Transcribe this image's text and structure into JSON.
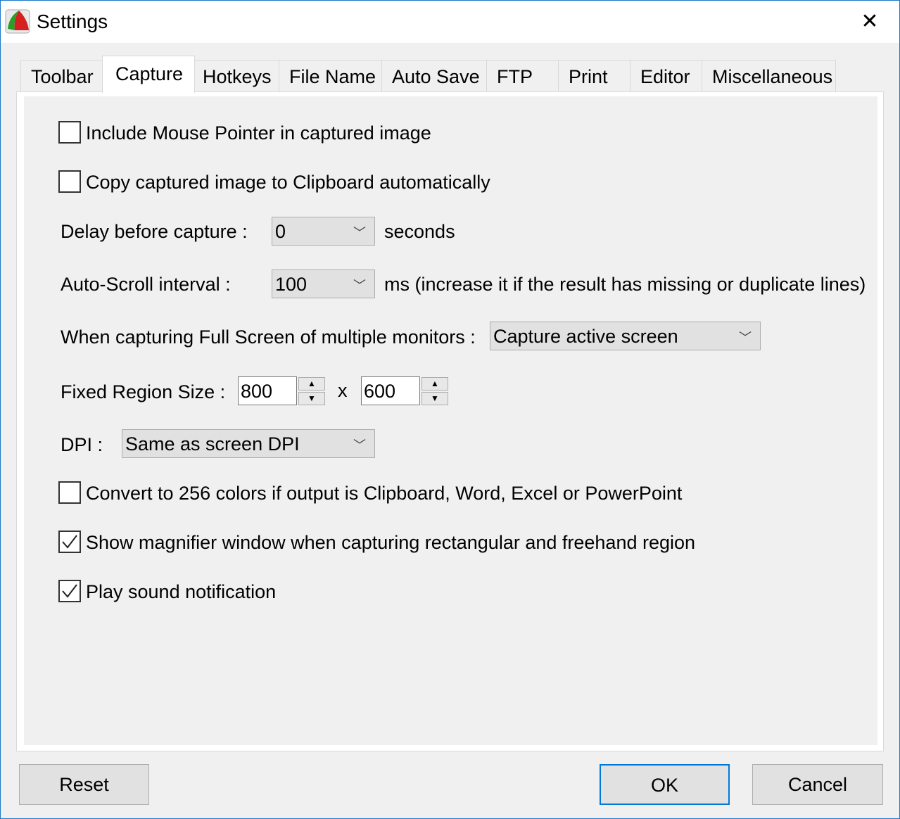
{
  "window": {
    "title": "Settings"
  },
  "tabs": [
    "Toolbar",
    "Capture",
    "Hotkeys",
    "File Name",
    "Auto Save",
    "FTP",
    "Print",
    "Editor",
    "Miscellaneous"
  ],
  "active_tab": "Capture",
  "options": {
    "include_mouse": {
      "label": "Include Mouse Pointer in captured image",
      "checked": false
    },
    "copy_clipboard": {
      "label": "Copy captured image to Clipboard automatically",
      "checked": false
    },
    "delay": {
      "label": "Delay before capture :",
      "value": "0",
      "unit": "seconds"
    },
    "autoscroll": {
      "label": "Auto-Scroll interval :",
      "value": "100",
      "unit": "ms (increase it if the result has missing or duplicate lines)"
    },
    "multi_monitor": {
      "label": "When capturing Full Screen of multiple monitors :",
      "value": "Capture active screen"
    },
    "fixed_region": {
      "label": "Fixed Region Size :",
      "width": "800",
      "sep": "x",
      "height": "600"
    },
    "dpi": {
      "label": "DPI :",
      "value": "Same as screen DPI"
    },
    "convert256": {
      "label": "Convert to 256 colors if output is Clipboard, Word, Excel or PowerPoint",
      "checked": false
    },
    "magnifier": {
      "label": "Show magnifier window when capturing rectangular and freehand region",
      "checked": true
    },
    "sound": {
      "label": "Play sound notification",
      "checked": true
    }
  },
  "buttons": {
    "reset": "Reset",
    "ok": "OK",
    "cancel": "Cancel"
  }
}
